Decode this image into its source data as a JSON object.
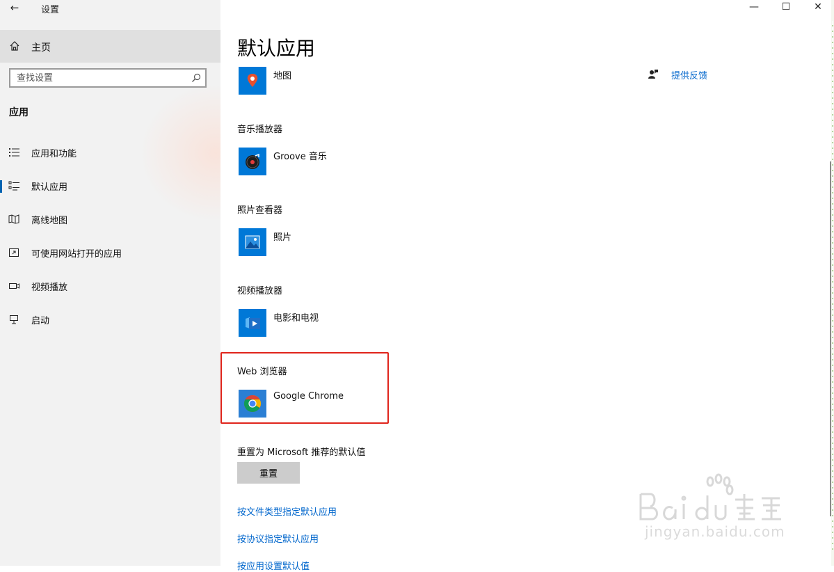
{
  "window": {
    "title": "设置",
    "back_glyph": "←",
    "minimize_glyph": "—",
    "maximize_glyph": "☐",
    "close_glyph": "✕"
  },
  "sidebar": {
    "home_label": "主页",
    "search_placeholder": "查找设置",
    "section_title": "应用",
    "items": [
      {
        "label": "应用和功能",
        "icon": "list-icon"
      },
      {
        "label": "默认应用",
        "icon": "default-apps-icon",
        "selected": true
      },
      {
        "label": "离线地图",
        "icon": "map-icon"
      },
      {
        "label": "可使用网站打开的应用",
        "icon": "website-app-icon"
      },
      {
        "label": "视频播放",
        "icon": "video-icon"
      },
      {
        "label": "启动",
        "icon": "startup-icon"
      }
    ]
  },
  "main": {
    "page_title": "默认应用",
    "feedback_label": "提供反馈",
    "defaults": [
      {
        "category": "",
        "app": "地图",
        "icon": "maps-app-icon"
      },
      {
        "category": "音乐播放器",
        "app": "Groove 音乐",
        "icon": "groove-music-icon"
      },
      {
        "category": "照片查看器",
        "app": "照片",
        "icon": "photos-app-icon"
      },
      {
        "category": "视频播放器",
        "app": "电影和电视",
        "icon": "movies-tv-icon"
      },
      {
        "category": "Web 浏览器",
        "app": "Google Chrome",
        "icon": "chrome-icon"
      }
    ],
    "reset_label": "重置为 Microsoft 推荐的默认值",
    "reset_button": "重置",
    "links": [
      "按文件类型指定默认应用",
      "按协议指定默认应用",
      "按应用设置默认值"
    ]
  },
  "watermark": {
    "text": "jingyan.baidu.com",
    "logo": "Bai du 经验"
  },
  "colors": {
    "accent": "#0078d7",
    "link": "#0066cc",
    "highlight": "#e0241b",
    "sidebar_bg": "#f2f2f2"
  }
}
